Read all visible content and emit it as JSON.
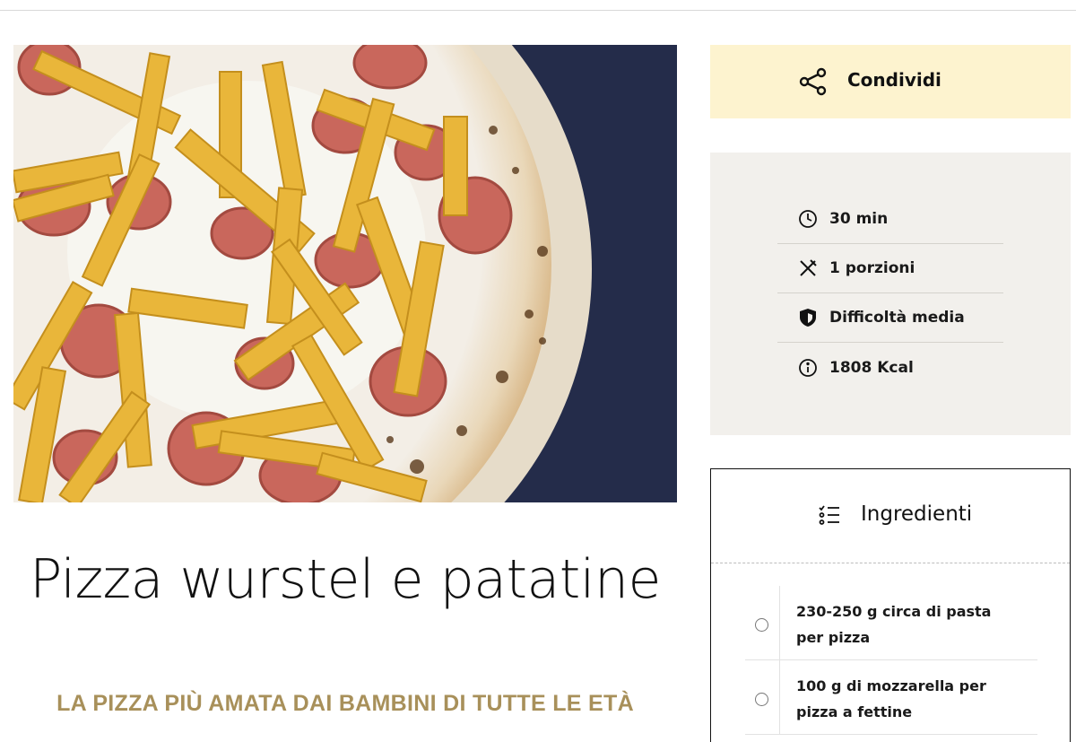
{
  "recipe": {
    "title": "Pizza wurstel e patatine",
    "subtitle": "LA PIZZA PIÙ AMATA DAI BAMBINI DI TUTTE LE ETÀ"
  },
  "share": {
    "label": "Condividi",
    "icon": "share-icon"
  },
  "info": [
    {
      "icon": "clock-icon",
      "text": "30 min"
    },
    {
      "icon": "fork-knife-icon",
      "text": "1 porzioni"
    },
    {
      "icon": "shield-icon",
      "text": "Difficoltà media"
    },
    {
      "icon": "info-icon",
      "text": "1808 Kcal"
    }
  ],
  "ingredients": {
    "title": "Ingredienti",
    "icon": "list-icon",
    "items": [
      "230-250 g circa di pasta per pizza",
      "100 g di mozzarella per pizza a fettine"
    ]
  },
  "colors": {
    "accent": "#a8905a",
    "share_bg": "#fdf3cf",
    "info_bg": "#f2f0ec"
  }
}
